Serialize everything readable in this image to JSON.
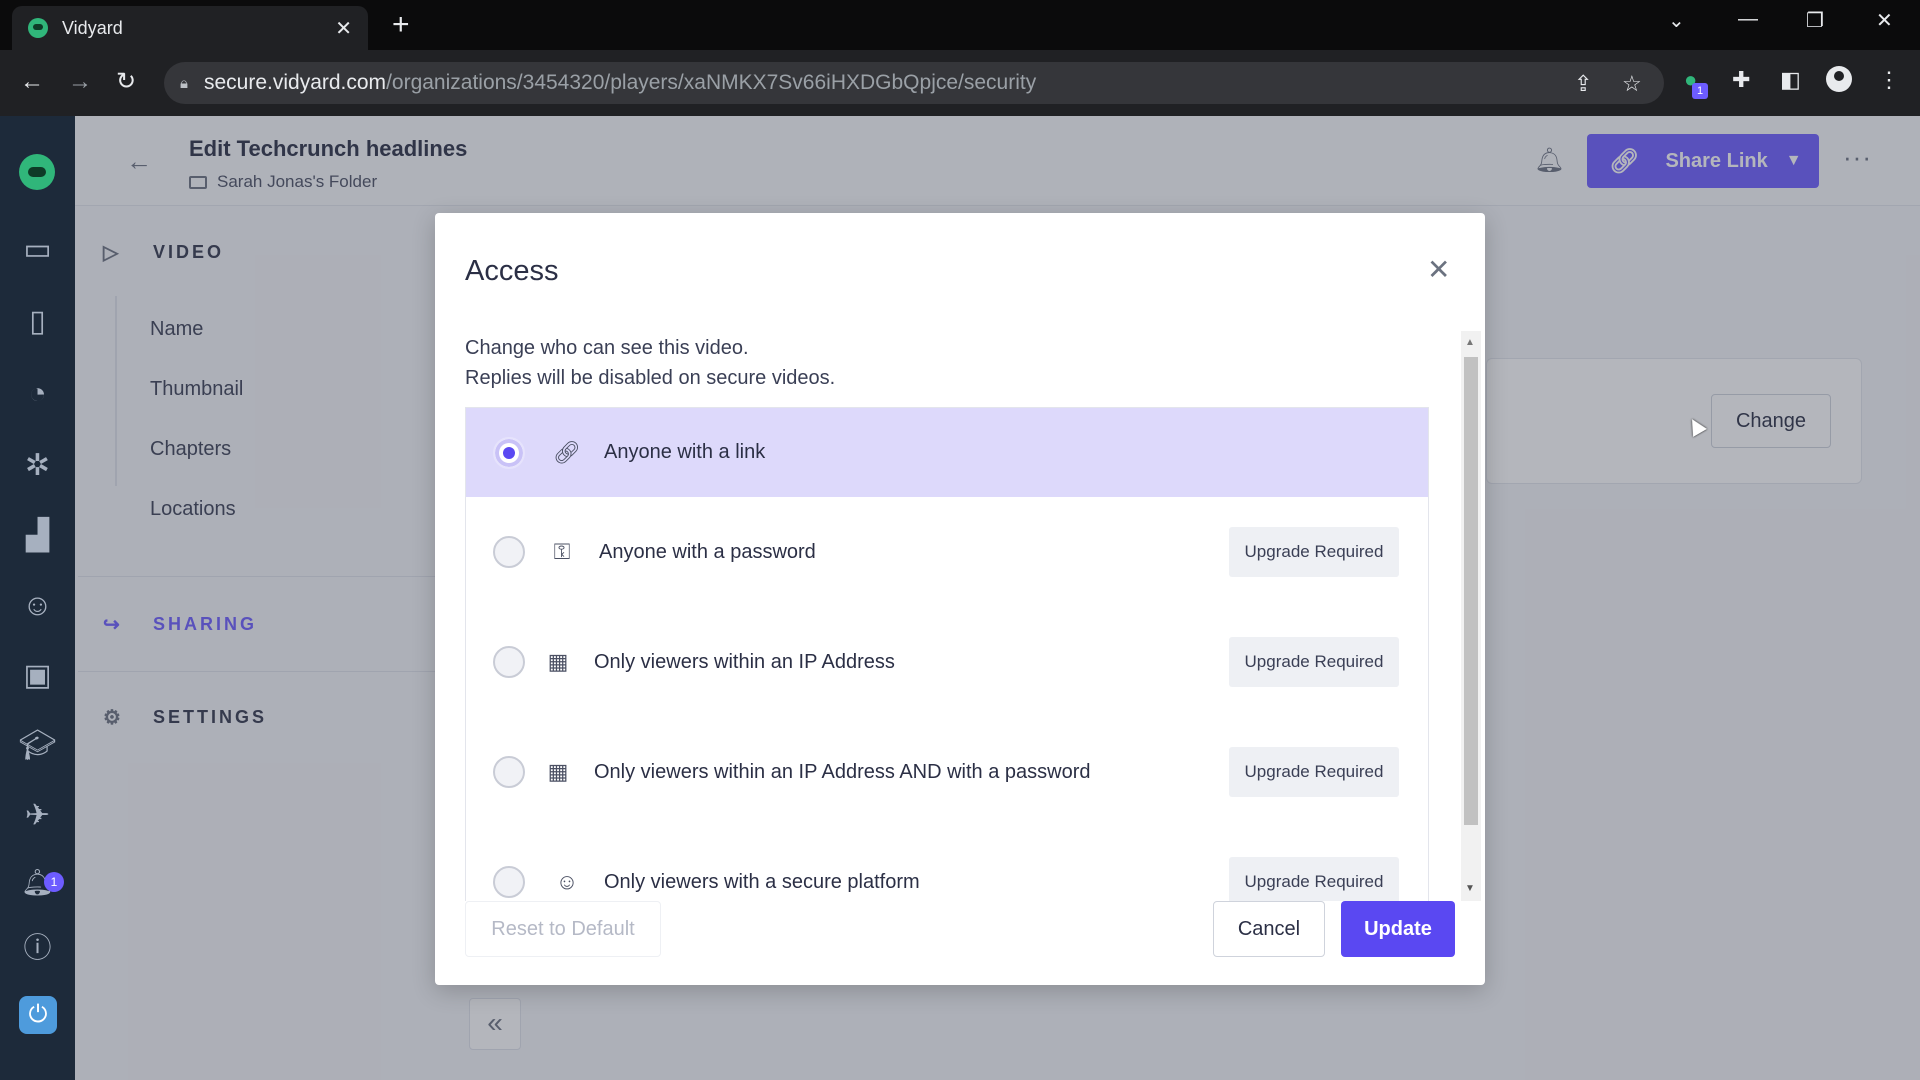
{
  "browser": {
    "tab_title": "Vidyard",
    "tab_close": "✕",
    "new_tab": "+",
    "url_host": "secure.vidyard.com",
    "url_path": "/organizations/3454320/players/xaNMKX7Sv66iHXDGbQpjce/security",
    "extension_badge": "1"
  },
  "app_rail": {
    "notifications_badge": "1"
  },
  "header": {
    "title": "Edit Techcrunch headlines",
    "folder": "Sarah Jonas's Folder",
    "share_label": "Share Link"
  },
  "settings_nav": {
    "video_section": "VIDEO",
    "video_items": [
      "Name",
      "Thumbnail",
      "Chapters",
      "Locations"
    ],
    "sharing_section": "SHARING",
    "settings_section": "SETTINGS"
  },
  "main": {
    "change_label": "Change"
  },
  "modal": {
    "title": "Access",
    "description_line1": "Change who can see this video.",
    "description_line2": "Replies will be disabled on secure videos.",
    "options": [
      {
        "label": "Anyone with a link",
        "icon": "link-icon",
        "selected": true,
        "badge": ""
      },
      {
        "label": "Anyone with a password",
        "icon": "key-icon",
        "selected": false,
        "badge": "Upgrade Required"
      },
      {
        "label": "Only viewers within an IP Address",
        "icon": "building-icon",
        "selected": false,
        "badge": "Upgrade Required"
      },
      {
        "label": "Only viewers within an IP Address AND with a password",
        "icon": "building-icon",
        "selected": false,
        "badge": "Upgrade Required"
      },
      {
        "label": "Only viewers with a secure platform",
        "icon": "user-lock-icon",
        "selected": false,
        "badge": "Upgrade Required"
      }
    ],
    "reset_label": "Reset to Default",
    "cancel_label": "Cancel",
    "update_label": "Update"
  },
  "colors": {
    "accent": "#6d5cff",
    "primary_button": "#5a48f2",
    "selected_row": "#ddd9fb",
    "sidebar": "#1d2a3a"
  }
}
